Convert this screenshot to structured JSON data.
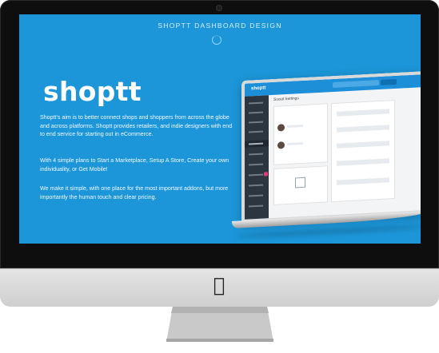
{
  "page": {
    "header_title": "SHOPTT DASHBOARD DESIGN",
    "logo_text": "shoptt",
    "paragraphs": [
      "Shoptt's aim is to better connect shops and shoppers from across the globe and across platforms. Shoptt provides retailers, and indie designers with end to end service for starting out in eCommerce.",
      "With 4 simple plans to Start a Marketplace, Setup A Store, Create your own individuality, or Get Mobile!",
      "We make it simple, with one place for the most important addons, but more importantly the human touch and clear pricing."
    ]
  },
  "laptop_ui": {
    "brand": "shoptt",
    "section_heading": "Social Settings"
  },
  "hardware": {
    "logo_icon": "apple-logo-icon"
  },
  "colors": {
    "background_blue": "#1c96d8",
    "bezel": "#0e0e0e",
    "chin": "#d9d9d9"
  }
}
